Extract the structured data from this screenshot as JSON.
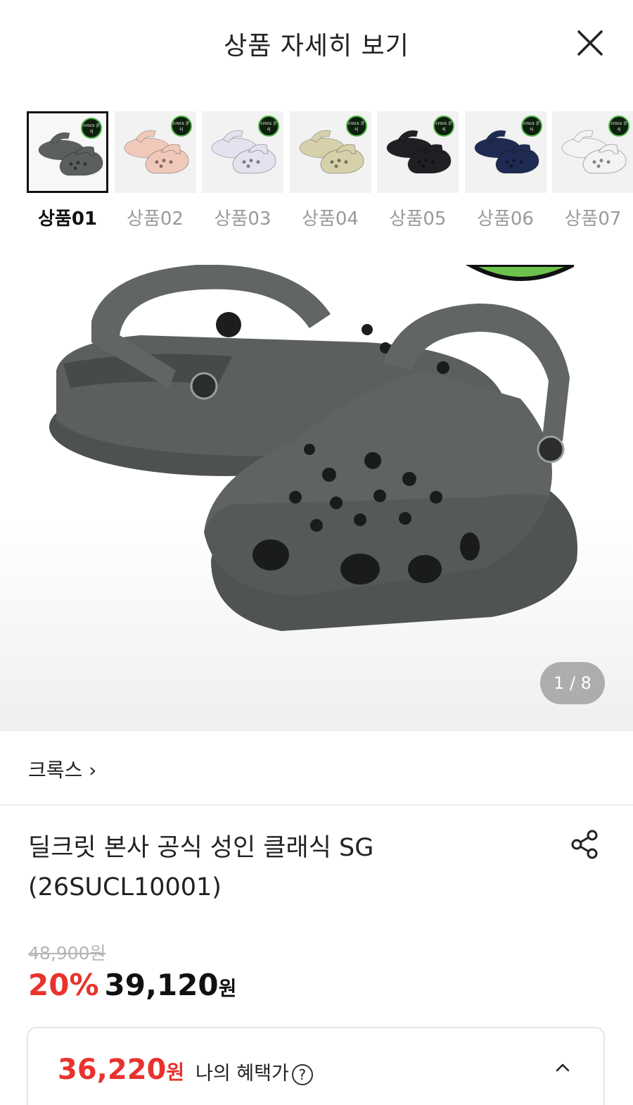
{
  "header": {
    "title": "상품 자세히 보기",
    "close_icon": "close-icon"
  },
  "thumbnails": [
    {
      "label": "상품01",
      "color": "#5b5f5e",
      "active": true,
      "badge": "crocs 공식"
    },
    {
      "label": "상품02",
      "color": "#f1c9bb",
      "active": false,
      "badge": "crocs 공식"
    },
    {
      "label": "상품03",
      "color": "#e4e2ee",
      "active": false,
      "badge": "crocs 공식"
    },
    {
      "label": "상품04",
      "color": "#d6d1ab",
      "active": false,
      "badge": "crocs 공식"
    },
    {
      "label": "상품05",
      "color": "#1f1f24",
      "active": false,
      "badge": "crocs 공식"
    },
    {
      "label": "상품06",
      "color": "#1f2b52",
      "active": false,
      "badge": "crocs 공식"
    },
    {
      "label": "상품07",
      "color": "#f3f3f3",
      "active": false,
      "badge": "crocs 공식"
    }
  ],
  "hero": {
    "pager": "1 / 8",
    "shoe_color": "#5b5f5e"
  },
  "brand": {
    "name": "크록스 ›"
  },
  "product": {
    "title": "딜크릿 본사 공식 성인 클래식 SG (26SUCL10001)",
    "share_icon": "share-icon"
  },
  "price": {
    "original": "48,900원",
    "discount": "20%",
    "sale": "39,120",
    "currency": "원"
  },
  "benefit": {
    "price": "36,220",
    "currency": "원",
    "label": "나의 혜택가",
    "help": "?",
    "caret_icon": "chevron-up-icon"
  },
  "colors": {
    "accent_red": "#e8332d",
    "text": "#222222",
    "muted": "#9a9a9a"
  }
}
